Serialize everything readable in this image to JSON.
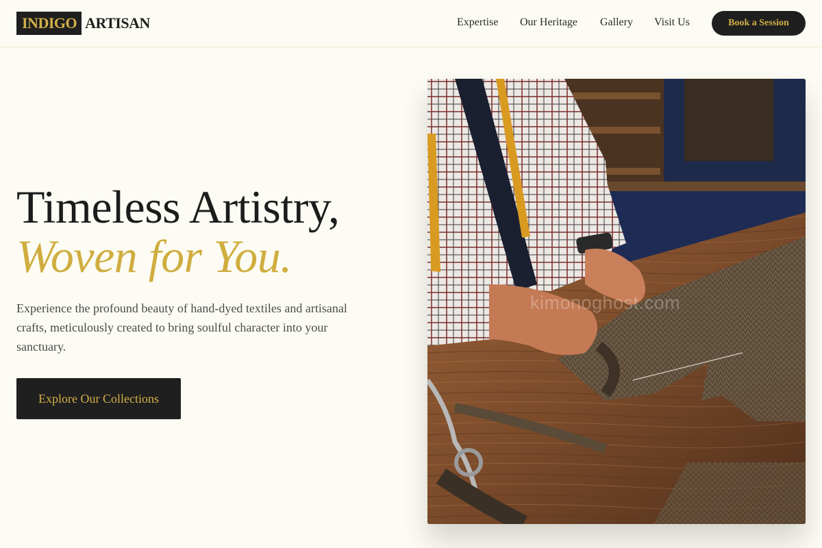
{
  "header": {
    "logo": {
      "mark": "INDIGO",
      "word": "ARTISAN"
    },
    "nav": [
      {
        "label": "Expertise"
      },
      {
        "label": "Our Heritage"
      },
      {
        "label": "Gallery"
      },
      {
        "label": "Visit Us"
      }
    ],
    "cta_label": "Book a Session"
  },
  "hero": {
    "title_line1": "Timeless Artistry,",
    "title_line2": "Woven for You.",
    "description": "Experience the profound beauty of hand-dyed textiles and artisanal crafts, meticulously created to bring soulful character into your sanctuary.",
    "button_label": "Explore Our Collections",
    "image": {
      "subject": "tailor cutting herringbone tweed fabric on a wooden workbench",
      "watermark": "kimonoghost.com"
    }
  },
  "colors": {
    "background": "#fdfcf4",
    "dark": "#1f1f1f",
    "gold_accent": "#cfad3f",
    "text_muted": "#4a4a4a"
  }
}
